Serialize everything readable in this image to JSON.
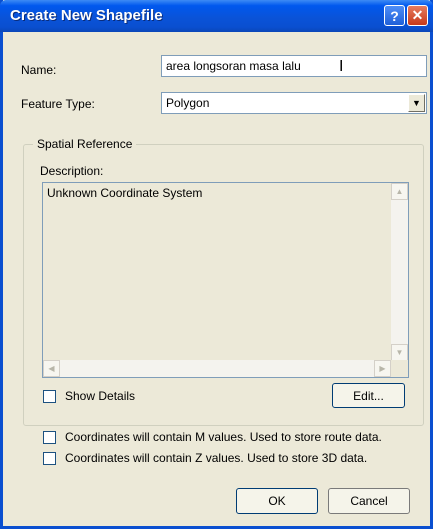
{
  "window": {
    "title": "Create New Shapefile",
    "help_label": "?",
    "close_label": "✕"
  },
  "form": {
    "name_label": "Name:",
    "name_value": "area longsoran masa lalu",
    "feature_type_label": "Feature Type:",
    "feature_type_value": "Polygon"
  },
  "spatial_reference": {
    "group_title": "Spatial Reference",
    "description_label": "Description:",
    "description_text": "Unknown Coordinate System",
    "show_details_label": "Show Details",
    "show_details_checked": false,
    "edit_label": "Edit..."
  },
  "options": {
    "m_values_label": "Coordinates will contain M values. Used to store route data.",
    "m_values_checked": false,
    "z_values_label": "Coordinates will contain Z values. Used to store 3D data.",
    "z_values_checked": false
  },
  "footer": {
    "ok_label": "OK",
    "cancel_label": "Cancel"
  },
  "icons": {
    "combo_arrow": "chevron-down-icon",
    "cursor": "text-cursor-icon"
  },
  "colors": {
    "title_bar": "#0a53d8",
    "dialog_bg": "#ece9d8",
    "input_border": "#7f9db9"
  }
}
